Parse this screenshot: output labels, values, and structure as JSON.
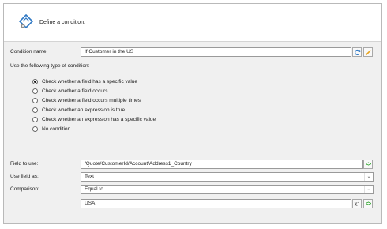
{
  "header": {
    "title": "Define a condition."
  },
  "condition": {
    "name_label": "Condition name:",
    "name_value": "If Customer in the US",
    "type_label": "Use the following type of condition:",
    "types": [
      {
        "label": "Check whether a field has a specific value",
        "checked": true
      },
      {
        "label": "Check whether a field occurs",
        "checked": false
      },
      {
        "label": "Check whether a field occurs multiple times",
        "checked": false
      },
      {
        "label": "Check whether an expression is true",
        "checked": false
      },
      {
        "label": "Check whether an expression has a specific value",
        "checked": false
      },
      {
        "label": "No condition",
        "checked": false
      }
    ]
  },
  "settings": {
    "field_label": "Field to use:",
    "field_value": "/Quote/CustomerId/Account/Address1_Country",
    "use_as_label": "Use field as:",
    "use_as_value": "Text",
    "comparison_label": "Comparison:",
    "comparison_value": "Equal to",
    "compare_value": "USA"
  },
  "icons": {
    "refresh": "refresh-icon",
    "wizard": "magic-wand-icon",
    "code": "code-brackets-icon",
    "expression": "x-squared-icon",
    "dropdown": "chevron-down-icon"
  },
  "colors": {
    "green": "#22a020",
    "orange": "#e8a21a",
    "blue": "#2f78c4"
  }
}
